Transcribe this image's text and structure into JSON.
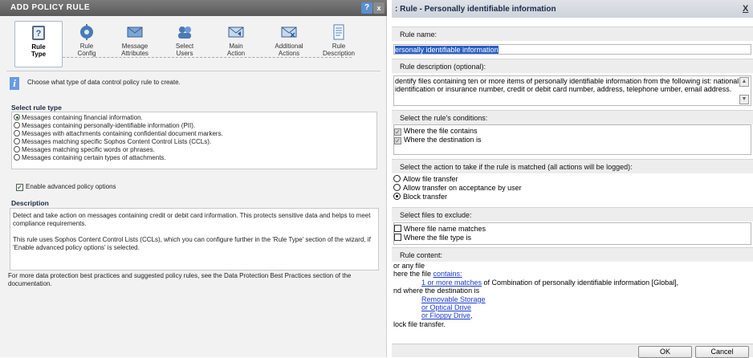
{
  "left": {
    "title": "ADD POLICY RULE",
    "help_glyph": "?",
    "close_glyph": "x",
    "steps": [
      {
        "label": "Rule\nType",
        "icon": "question-book-icon"
      },
      {
        "label": "Rule\nConfig",
        "icon": "gear-icon"
      },
      {
        "label": "Message\nAttributes",
        "icon": "envelope-icon"
      },
      {
        "label": "Select\nUsers",
        "icon": "users-icon"
      },
      {
        "label": "Main\nAction",
        "icon": "envelope-action-icon"
      },
      {
        "label": "Additional\nActions",
        "icon": "envelope-x-icon"
      },
      {
        "label": "Rule\nDescription",
        "icon": "document-icon"
      }
    ],
    "info_glyph": "i",
    "intro": "Choose what type of data control policy rule to create.",
    "select_rule_type": "Select rule type",
    "rule_types": [
      "Messages containing financial information.",
      "Messages containing personally-identifiable information (PII).",
      "Messages with attachments containing confidential document markers.",
      "Messages matching specific Sophos Content Control Lists (CCLs).",
      "Messages matching specific words or phrases.",
      "Messages containing certain types of attachments."
    ],
    "advanced_label": "Enable advanced policy options",
    "advanced_checked_glyph": "✓",
    "description_heading": "Description",
    "description_p1": "Detect and take action on messages containing credit or debit card information. This protects sensitive data and helps to meet compliance requirements.",
    "description_p2": "This rule uses Sophos Content Control Lists (CCLs), which you can configure further in the 'Rule Type' section of the wizard, if 'Enable advanced policy options' is selected.",
    "more_info": "For more data protection best practices and suggested policy rules, see the Data Protection Best Practices section of the documentation."
  },
  "right": {
    "title": ": Rule - Personally identifiable information",
    "close_glyph": "X",
    "rule_name_label": "Rule name:",
    "rule_name_value": "ersonally identifiable information",
    "rule_desc_label": "Rule description (optional):",
    "rule_desc_value": "dentify files containing ten or more items of personally identifiable information from the following ist: national identification or insurance number, credit or debit card number, address, telephone umber, email address.",
    "scroll_up": "▲",
    "scroll_down": "▼",
    "conditions_label": "Select the rule's conditions:",
    "conditions": [
      "Where the file contains",
      "Where the destination is"
    ],
    "check_glyph": "✓",
    "action_label": "Select the action to take if the rule is matched (all actions will be logged):",
    "actions": [
      "Allow file transfer",
      "Allow transfer on acceptance by user",
      "Block transfer"
    ],
    "exclude_label": "Select files to exclude:",
    "excludes": [
      "Where file name matches",
      "Where the file type is"
    ],
    "content_label": "Rule content:",
    "content": {
      "line1": "or any file",
      "line2_prefix": "here the file ",
      "line2_link": "contains:",
      "line3_link": "1  or more matches",
      "line3_suffix": " of Combination of personally identifiable information [Global],",
      "line4": "nd where the destination is",
      "line5_link": "Removable Storage",
      "line6_link": "or Optical Drive",
      "line7_link": "or Floppy Drive",
      "line7_suffix": ",",
      "line8": "lock file transfer."
    },
    "ok": "OK",
    "cancel": "Cancel"
  }
}
